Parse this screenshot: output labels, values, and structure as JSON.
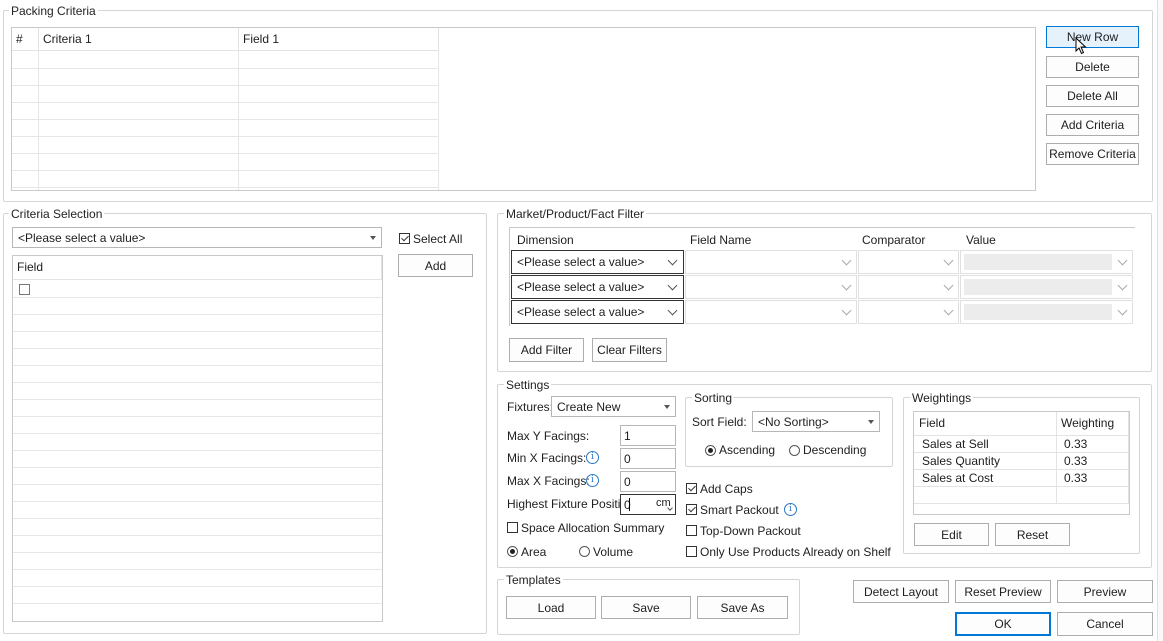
{
  "packing_criteria": {
    "title": "Packing Criteria",
    "columns": [
      "#",
      "Criteria 1",
      "Field 1"
    ],
    "buttons": {
      "new_row": "New Row",
      "delete": "Delete",
      "delete_all": "Delete All",
      "add_criteria": "Add Criteria",
      "remove_criteria": "Remove Criteria"
    }
  },
  "criteria_selection": {
    "title": "Criteria Selection",
    "dropdown_value": "<Please select a value>",
    "select_all_label": "Select All",
    "add_label": "Add",
    "column_field": "Field"
  },
  "filter": {
    "title": "Market/Product/Fact Filter",
    "columns": [
      "Dimension",
      "Field Name",
      "Comparator",
      "Value"
    ],
    "rows": [
      {
        "dimension": "<Please select a value>"
      },
      {
        "dimension": "<Please select a value>"
      },
      {
        "dimension": "<Please select a value>"
      }
    ],
    "add_filter": "Add Filter",
    "clear_filters": "Clear Filters"
  },
  "settings": {
    "title": "Settings",
    "fixtures_label": "Fixtures:",
    "fixtures_value": "Create New",
    "max_y_label": "Max Y Facings:",
    "max_y_value": "1",
    "min_x_label": "Min X Facings:",
    "min_x_value": "0",
    "max_x_label": "Max X Facings:",
    "max_x_value": "0",
    "highest_label": "Highest Fixture Position:",
    "highest_value": "0",
    "highest_unit": "cm",
    "space_alloc_label": "Space Allocation Summary",
    "area_label": "Area",
    "volume_label": "Volume",
    "sorting": {
      "title": "Sorting",
      "sort_field_label": "Sort Field:",
      "sort_field_value": "<No Sorting>",
      "ascending": "Ascending",
      "descending": "Descending"
    },
    "add_caps": "Add Caps",
    "smart_packout": "Smart Packout",
    "top_down": "Top-Down Packout",
    "only_use": "Only Use Products Already on Shelf"
  },
  "weightings": {
    "title": "Weightings",
    "columns": [
      "Field",
      "Weighting"
    ],
    "rows": [
      {
        "field": "Sales at Sell",
        "weight": "0.33"
      },
      {
        "field": "Sales Quantity",
        "weight": "0.33"
      },
      {
        "field": "Sales at Cost",
        "weight": "0.33"
      }
    ],
    "edit": "Edit",
    "reset": "Reset"
  },
  "templates": {
    "title": "Templates",
    "load": "Load",
    "save": "Save",
    "save_as": "Save As"
  },
  "footer": {
    "detect_layout": "Detect Layout",
    "reset_preview": "Reset Preview",
    "preview": "Preview",
    "ok": "OK",
    "cancel": "Cancel"
  }
}
